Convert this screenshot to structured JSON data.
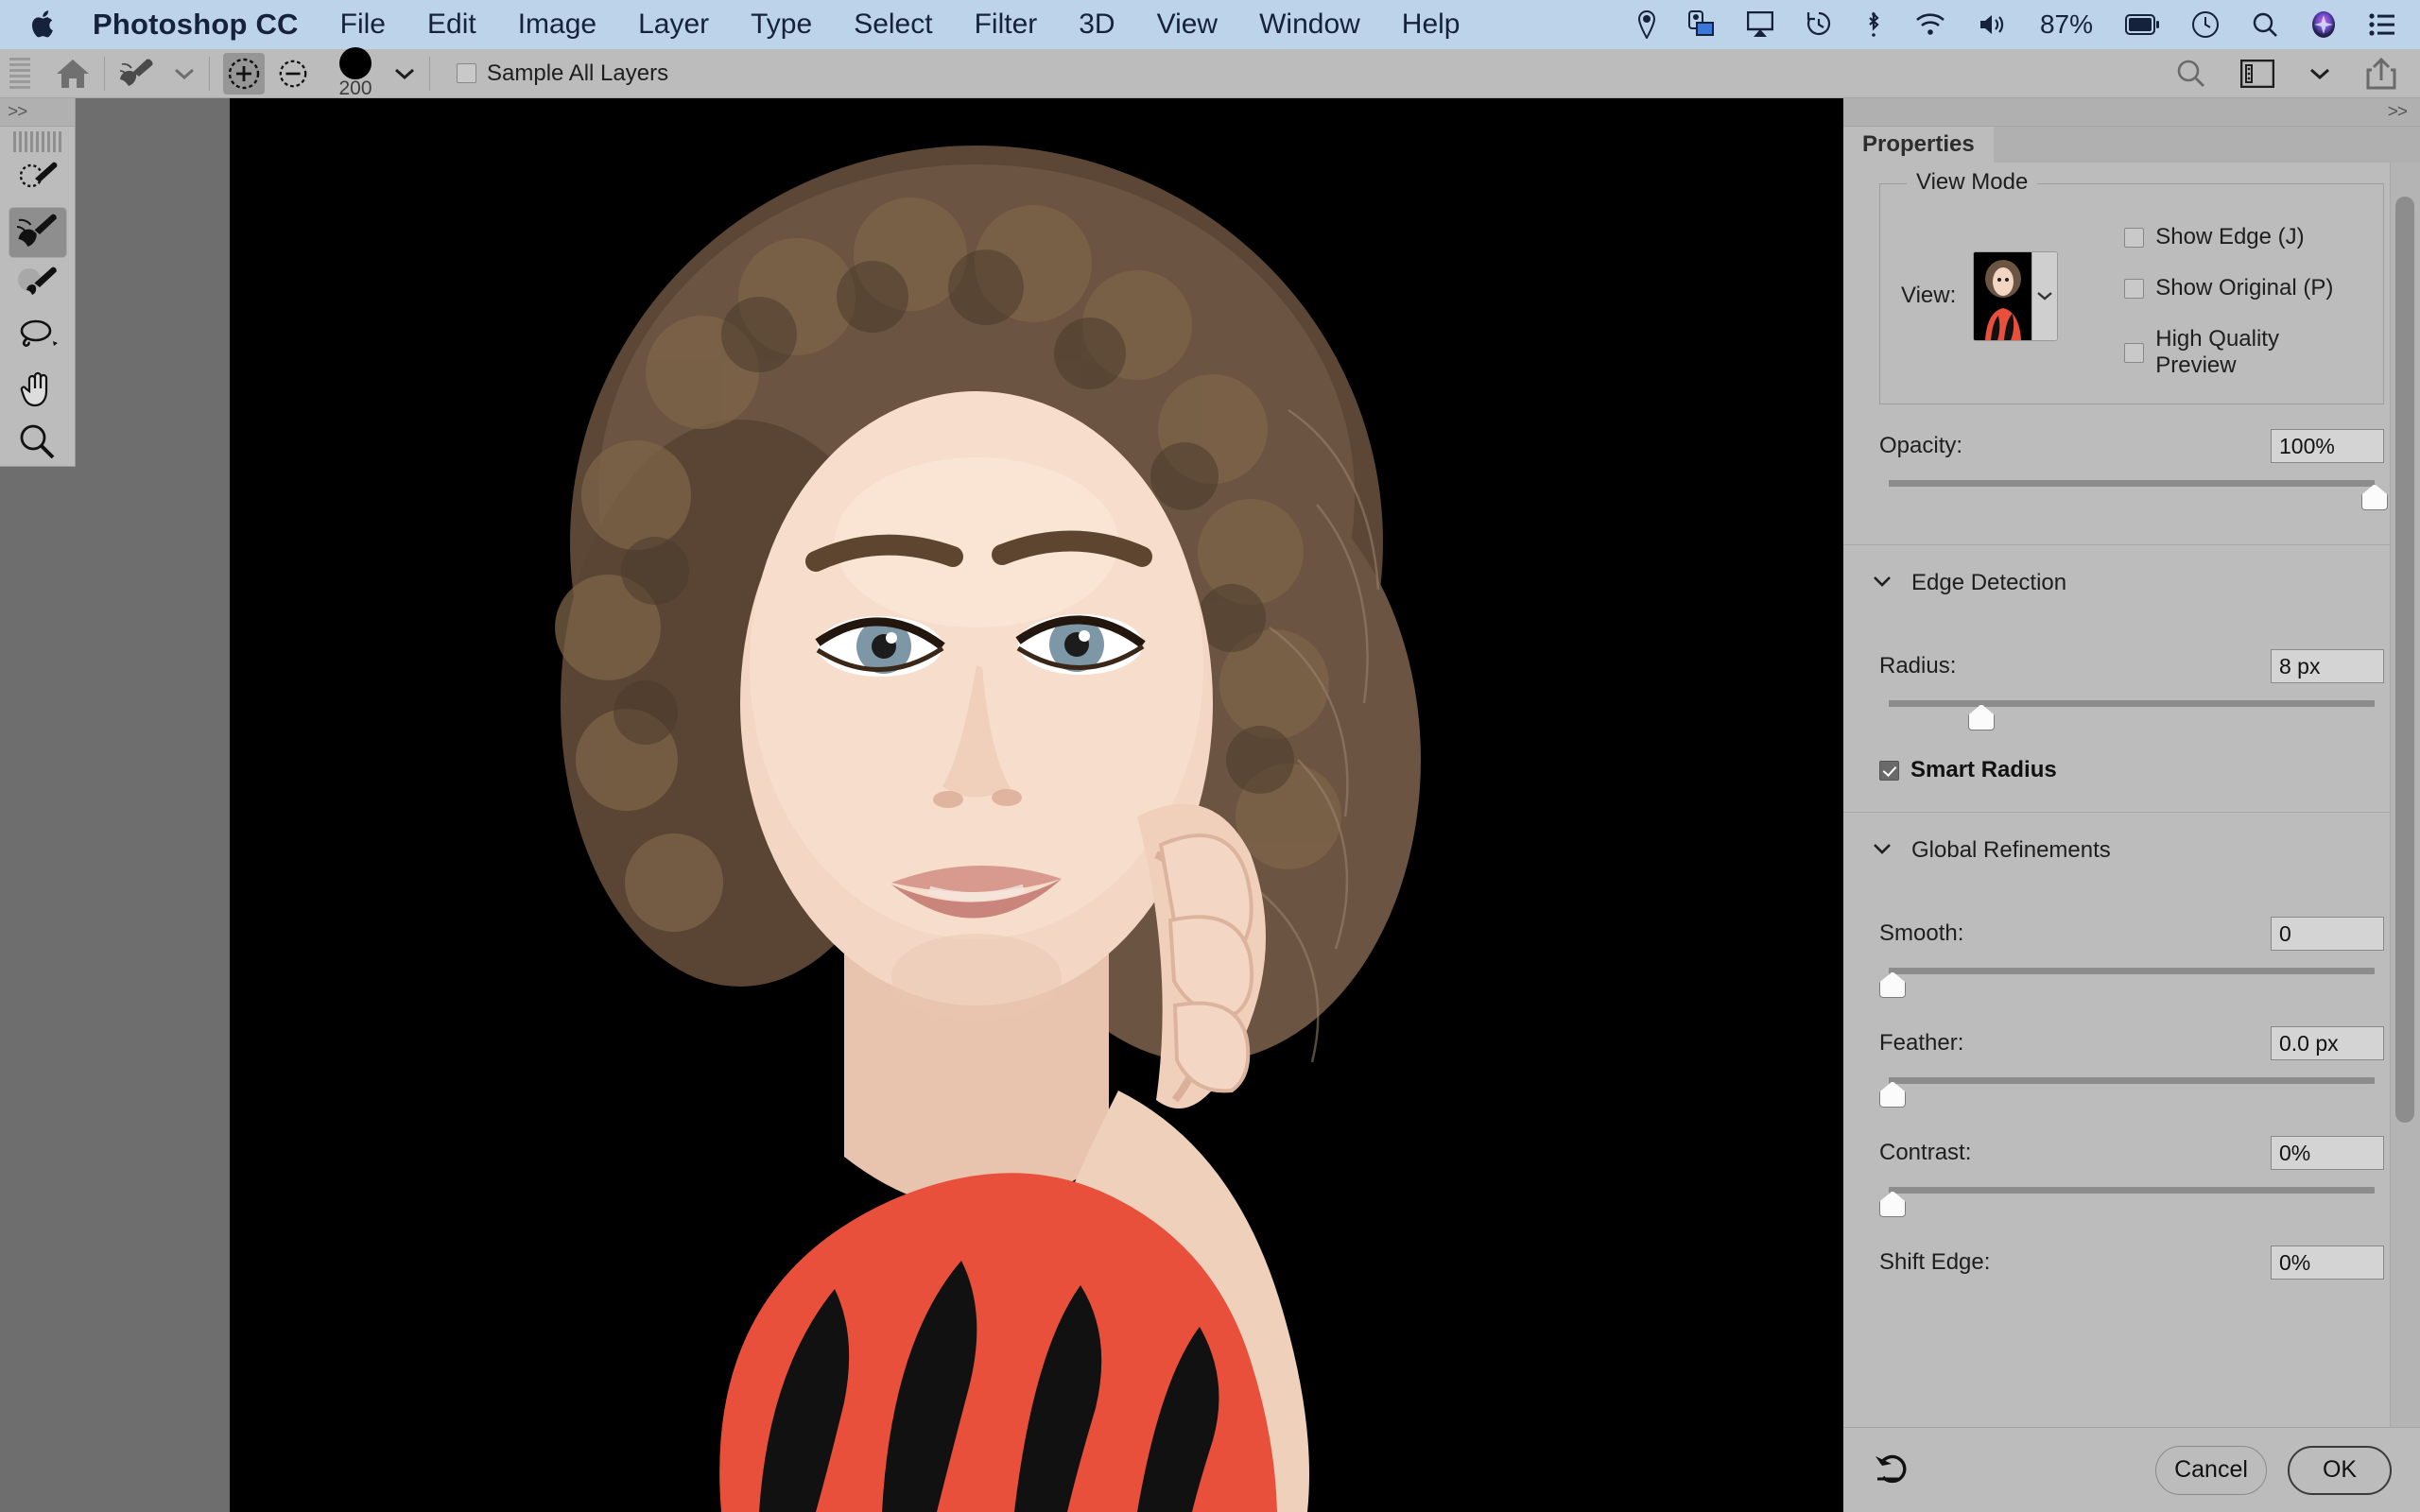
{
  "menubar": {
    "apple_icon": "apple-logo-icon",
    "app_title": "Photoshop CC",
    "menus": [
      {
        "label": "File"
      },
      {
        "label": "Edit"
      },
      {
        "label": "Image"
      },
      {
        "label": "Layer"
      },
      {
        "label": "Type"
      },
      {
        "label": "Select"
      },
      {
        "label": "Filter"
      },
      {
        "label": "3D"
      },
      {
        "label": "View"
      },
      {
        "label": "Window"
      },
      {
        "label": "Help"
      }
    ],
    "status_icons": [
      "location-pin-icon",
      "screen-sharing-icon",
      "airplay-icon",
      "time-machine-icon",
      "bluetooth-icon",
      "wifi-icon",
      "volume-icon"
    ],
    "battery_percent": "87%",
    "trailing_icons": [
      "battery-icon",
      "clock-icon",
      "spotlight-search-icon",
      "siri-icon",
      "control-center-icon"
    ],
    "bar_color": "#bdd3ea",
    "text_color": "#16213c"
  },
  "options_bar": {
    "home_icon": "home-icon",
    "tool_preset_icon": "refine-edge-brush-icon",
    "tool_preset_chevron": "chevron-down-icon",
    "mode_add_icon": "add-to-selection-icon",
    "mode_subtract_icon": "subtract-from-selection-icon",
    "brush_size": "200",
    "brush_chevron": "chevron-down-icon",
    "sample_all_layers_label": "Sample All Layers",
    "sample_all_layers_checked": false,
    "right_icons": [
      "search-icon",
      "workspace-icon",
      "chevron-down-icon",
      "share-icon"
    ]
  },
  "toolbar": {
    "collapse_label": ">>",
    "tools": [
      {
        "name": "quick-selection-tool",
        "icon": "quick-selection-brush-icon",
        "selected": false
      },
      {
        "name": "refine-edge-brush-tool",
        "icon": "refine-edge-brush-icon",
        "selected": true
      },
      {
        "name": "brush-tool",
        "icon": "brush-icon",
        "selected": false
      },
      {
        "name": "lasso-tool",
        "icon": "lasso-icon",
        "selected": false
      },
      {
        "name": "hand-tool",
        "icon": "hand-icon",
        "selected": false
      },
      {
        "name": "zoom-tool",
        "icon": "magnifier-icon",
        "selected": false
      }
    ]
  },
  "canvas": {
    "background_color": "#6e6e6e",
    "image_background": "#000000",
    "description": "Portrait of a woman with curly brown hair on black background wearing a red and black striped top, hand raised to her ear"
  },
  "properties_panel": {
    "collapse_label": ">>",
    "tab_label": "Properties",
    "view_mode": {
      "legend": "View Mode",
      "view_label": "View:",
      "view_swatch_icon": "view-preview-thumbnail",
      "view_chevron": "chevron-down-icon",
      "checkboxes": [
        {
          "label": "Show Edge (J)",
          "checked": false
        },
        {
          "label": "Show Original (P)",
          "checked": false
        },
        {
          "label": "High Quality Preview",
          "checked": false
        }
      ]
    },
    "opacity": {
      "label": "Opacity:",
      "value": "100%",
      "slider_percent": 100
    },
    "edge_detection": {
      "title": "Edge Detection",
      "chevron": "chevron-down-icon",
      "radius": {
        "label": "Radius:",
        "value": "8 px",
        "slider_percent": 16
      },
      "smart_radius": {
        "label": "Smart Radius",
        "checked": true
      }
    },
    "global_refinements": {
      "title": "Global Refinements",
      "chevron": "chevron-down-icon",
      "sliders": [
        {
          "label": "Smooth:",
          "value": "0",
          "slider_percent": 0
        },
        {
          "label": "Feather:",
          "value": "0.0 px",
          "slider_percent": 0
        },
        {
          "label": "Contrast:",
          "value": "0%",
          "slider_percent": 0
        },
        {
          "label": "Shift Edge:",
          "value": "0%",
          "slider_percent": 0
        }
      ]
    },
    "footer": {
      "reset_icon": "reset-undo-icon",
      "cancel_label": "Cancel",
      "ok_label": "OK"
    }
  }
}
